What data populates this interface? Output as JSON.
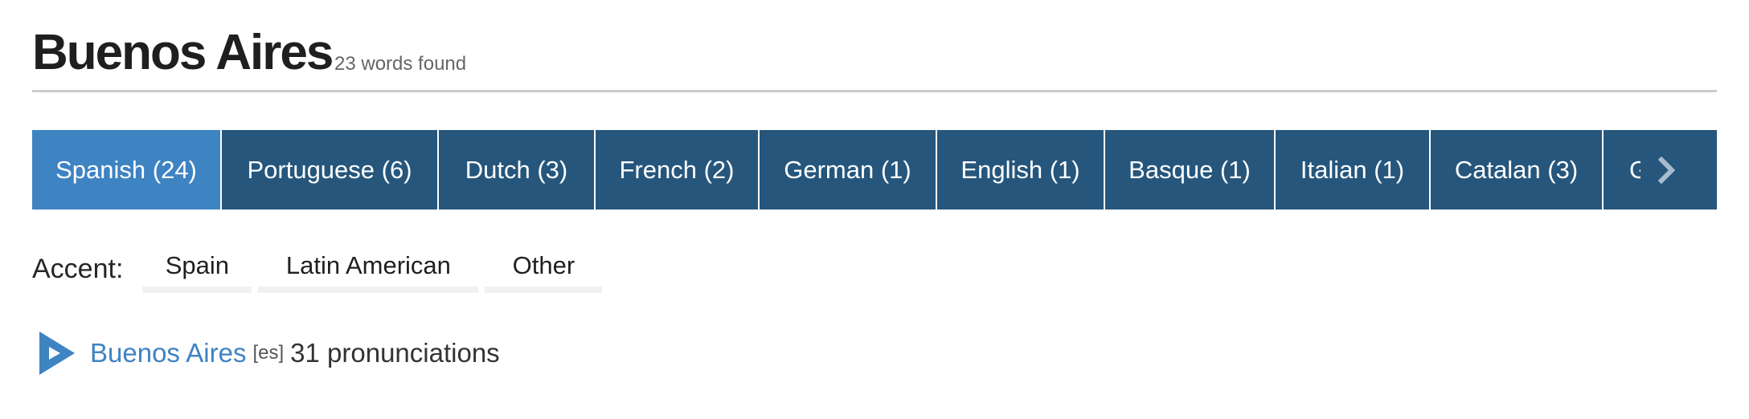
{
  "header": {
    "title": "Buenos Aires",
    "subtitle": "23 words found"
  },
  "language_tabs": [
    {
      "label": "Spanish (24)",
      "active": true
    },
    {
      "label": "Portuguese (6)",
      "active": false
    },
    {
      "label": "Dutch (3)",
      "active": false
    },
    {
      "label": "French (2)",
      "active": false
    },
    {
      "label": "German (1)",
      "active": false
    },
    {
      "label": "English (1)",
      "active": false
    },
    {
      "label": "Basque (1)",
      "active": false
    },
    {
      "label": "Italian (1)",
      "active": false
    },
    {
      "label": "Catalan (3)",
      "active": false
    },
    {
      "label": "G",
      "active": false,
      "truncated": true
    }
  ],
  "tabs_next_icon": "chevron-right-icon",
  "accent": {
    "label": "Accent:",
    "options": [
      "Spain",
      "Latin American",
      "Other"
    ]
  },
  "word_entry": {
    "play_icon": "play-icon",
    "word": "Buenos Aires",
    "lang_code": "[es]",
    "pronunciations": "31 pronunciations"
  },
  "colors": {
    "tab_active": "#3e83c2",
    "tab_inactive": "#26567c",
    "link": "#3e83c2"
  }
}
